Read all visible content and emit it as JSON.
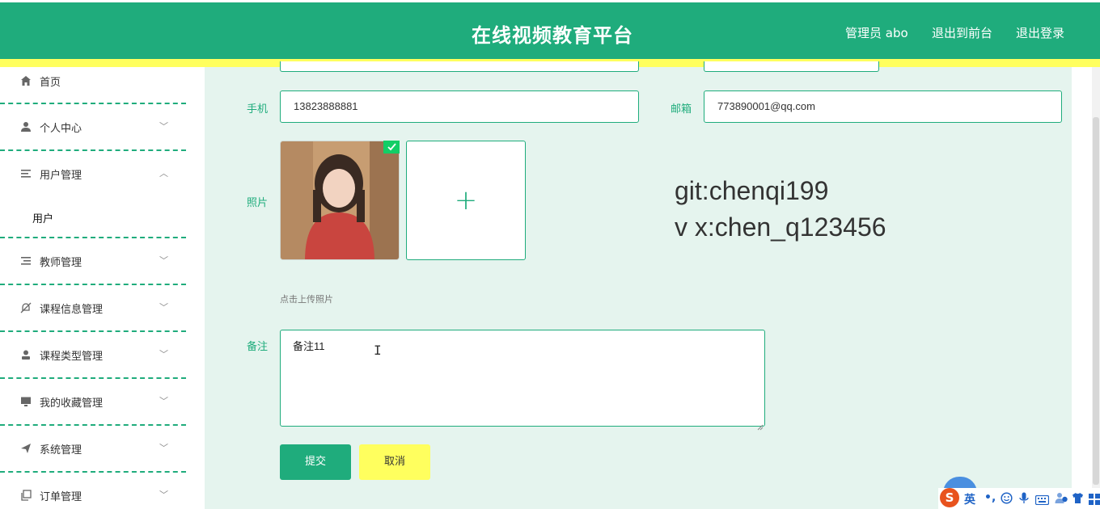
{
  "header": {
    "title": "在线视频教育平台",
    "user_label": "管理员 abo",
    "back_to_front": "退出到前台",
    "logout": "退出登录",
    "colors": {
      "primary": "#1fac7c",
      "accent": "#ffff5e"
    }
  },
  "sidebar": {
    "items": [
      {
        "label": "首页",
        "icon": "home-icon"
      },
      {
        "label": "个人中心",
        "icon": "person-icon"
      },
      {
        "label": "用户管理",
        "icon": "list-icon",
        "expanded": true,
        "children": [
          "用户"
        ]
      },
      {
        "label": "教师管理",
        "icon": "list-icon"
      },
      {
        "label": "课程信息管理",
        "icon": "bell-off-icon"
      },
      {
        "label": "课程类型管理",
        "icon": "user-icon"
      },
      {
        "label": "我的收藏管理",
        "icon": "monitor-icon"
      },
      {
        "label": "系统管理",
        "icon": "send-icon"
      },
      {
        "label": "订单管理",
        "icon": "copy-icon"
      }
    ]
  },
  "form": {
    "phone_label": "手机",
    "phone_value": "13823888881",
    "email_label": "邮箱",
    "email_value": "773890001@qq.com",
    "photo_label": "照片",
    "upload_hint": "点击上传照片",
    "remark_label": "备注",
    "remark_value": "备注11",
    "submit_label": "提交",
    "cancel_label": "取消"
  },
  "overlay_text": {
    "line1": "git:chenqi199",
    "line2": "v x:chen_q123456"
  },
  "ime": {
    "logo": "S",
    "mode": "英",
    "punct": "•,",
    "icons": [
      "emoji-icon",
      "mic-icon",
      "keyboard-icon",
      "user-icon",
      "shirt-icon",
      "grid-icon"
    ]
  }
}
